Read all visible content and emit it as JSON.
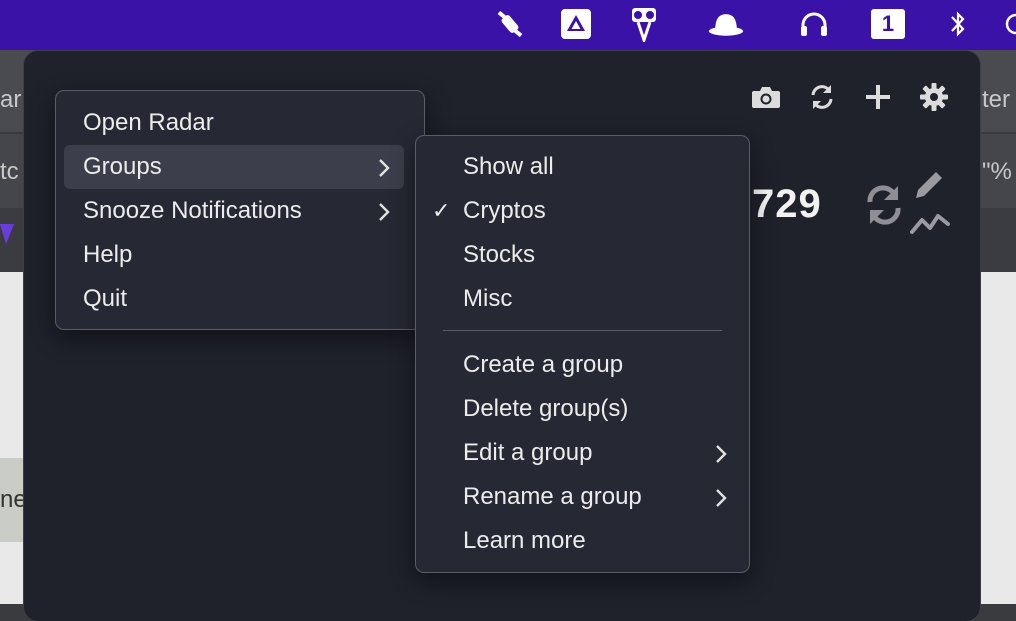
{
  "colors": {
    "menubar": "#3a12a8",
    "popover_bg": "#1f212b",
    "menu_bg": "#262833",
    "highlight": "#3c3e4b"
  },
  "menubar_icons": [
    "satellite-icon",
    "drive-icon",
    "scissors-icon",
    "hat-icon",
    "headphones-icon",
    "one-password-icon",
    "bluetooth-icon"
  ],
  "menubar_one_label": "1",
  "background": {
    "fragment_left_1": "ar",
    "fragment_left_2": "tc",
    "fragment_left_3": "ne",
    "fragment_right_1": "ter",
    "fragment_right_2": "\"%"
  },
  "toolbar": {
    "icons": [
      "camera-icon",
      "refresh-icon",
      "add-icon",
      "gear-icon"
    ]
  },
  "price_fragment": "729",
  "main_menu": {
    "items": [
      {
        "label": "Open Radar",
        "submenu": false
      },
      {
        "label": "Groups",
        "submenu": true,
        "highlighted": true
      },
      {
        "label": "Snooze Notifications",
        "submenu": true
      },
      {
        "label": "Help",
        "submenu": false
      },
      {
        "label": "Quit",
        "submenu": false
      }
    ],
    "chevron": ">"
  },
  "groups_menu": {
    "section1": [
      {
        "label": "Show all",
        "checked": false
      },
      {
        "label": "Cryptos",
        "checked": true
      },
      {
        "label": "Stocks",
        "checked": false
      },
      {
        "label": "Misc",
        "checked": false
      }
    ],
    "section2": [
      {
        "label": "Create a group",
        "submenu": false
      },
      {
        "label": "Delete group(s)",
        "submenu": false
      },
      {
        "label": "Edit a group",
        "submenu": true
      },
      {
        "label": "Rename a group",
        "submenu": true
      },
      {
        "label": "Learn more",
        "submenu": false
      }
    ],
    "check_glyph": "✓",
    "chevron": ">"
  }
}
